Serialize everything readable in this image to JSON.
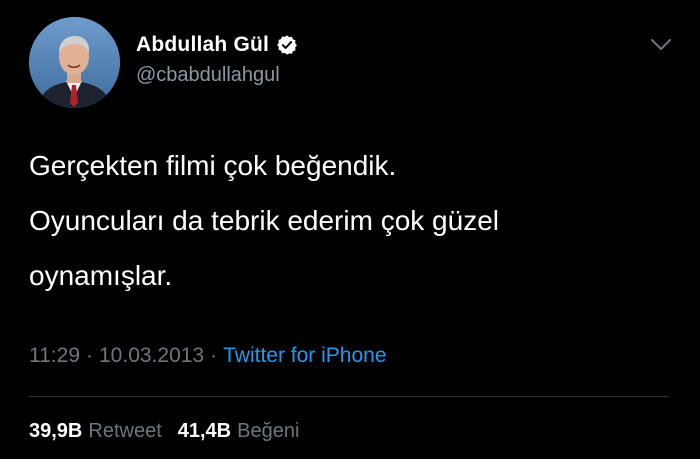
{
  "tweet": {
    "display_name": "Abdullah Gül",
    "handle": "@cbabdullahgul",
    "verified": true,
    "text_lines": [
      "Gerçekten filmi çok beğendik.",
      "Oyuncuları da tebrik ederim çok güzel",
      "oynamışlar."
    ],
    "time": "11:29",
    "date": "10.03.2013",
    "separator": "·",
    "source": "Twitter for iPhone",
    "retweet_count": "39,9B",
    "retweet_label": "Retweet",
    "like_count": "41,4B",
    "like_label": "Beğeni"
  },
  "icons": {
    "avatar": "profile-photo",
    "verified": "verified-badge-icon",
    "menu": "chevron-down-icon"
  },
  "colors": {
    "background": "#000000",
    "primary_text": "#ffffff",
    "secondary_text": "#6e767d",
    "handle_text": "#8b98a5",
    "link": "#1d9bf0",
    "divider": "#2f3336"
  }
}
